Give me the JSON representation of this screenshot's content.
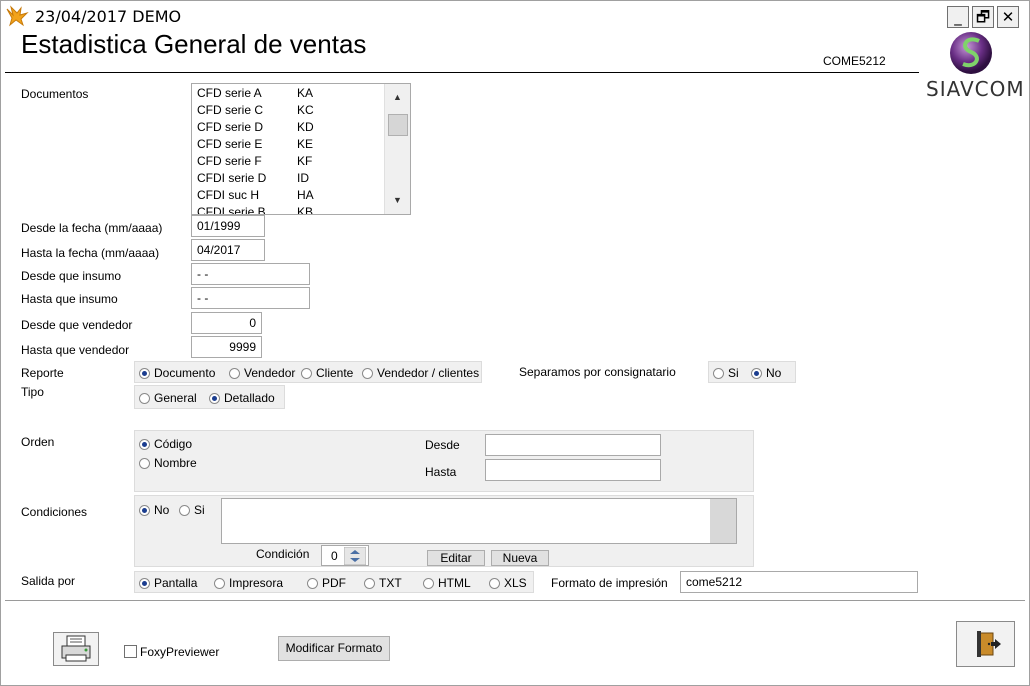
{
  "window": {
    "title": "23/04/2017  DEMO",
    "controls": {
      "minimize": "_",
      "restore": "🗗",
      "close": "✕"
    }
  },
  "header": {
    "heading": "Estadistica General de ventas",
    "program_code": "COME5212",
    "logo_text": "SIAVCOM"
  },
  "documentos": {
    "label": "Documentos",
    "items": [
      {
        "name": "CFD serie A",
        "code": "KA"
      },
      {
        "name": "CFD serie C",
        "code": "KC"
      },
      {
        "name": "CFD serie D",
        "code": "KD"
      },
      {
        "name": "CFD serie E",
        "code": "KE"
      },
      {
        "name": "CFD serie F",
        "code": "KF"
      },
      {
        "name": "CFDI  serie D",
        "code": "ID"
      },
      {
        "name": "CFDI  suc  H",
        "code": "HA"
      },
      {
        "name": "CFDI serie B",
        "code": "KB"
      }
    ]
  },
  "fields": {
    "desde_fecha": {
      "label": "Desde la fecha (mm/aaaa)",
      "value": "01/1999"
    },
    "hasta_fecha": {
      "label": "Hasta la fecha (mm/aaaa)",
      "value": "04/2017"
    },
    "desde_insumo": {
      "label": "Desde que insumo",
      "value": " - -"
    },
    "hasta_insumo": {
      "label": "Hasta que insumo",
      "value": " - -"
    },
    "desde_vendedor": {
      "label": "Desde que vendedor",
      "value": "0"
    },
    "hasta_vendedor": {
      "label": "Hasta que vendedor",
      "value": "9999"
    }
  },
  "reporte": {
    "label": "Reporte",
    "options": [
      "Documento",
      "Vendedor",
      "Cliente",
      "Vendedor / clientes"
    ],
    "selected": "Documento"
  },
  "consignatario": {
    "label": "Separamos por consignatario",
    "options": [
      "Si",
      "No"
    ],
    "selected": "No"
  },
  "tipo": {
    "label": "Tipo",
    "options": [
      "General",
      "Detallado"
    ],
    "selected": "Detallado"
  },
  "orden": {
    "label": "Orden",
    "options": [
      "Código",
      "Nombre"
    ],
    "selected": "Código",
    "desde_label": "Desde",
    "hasta_label": "Hasta",
    "desde_value": "",
    "hasta_value": ""
  },
  "condiciones": {
    "label": "Condiciones",
    "options": [
      "No",
      "Si"
    ],
    "selected": "No",
    "condicion_label": "Condición",
    "condicion_value": "0",
    "editar_label": "Editar",
    "nueva_label": "Nueva"
  },
  "salida": {
    "label": "Salida por",
    "options": [
      "Pantalla",
      "Impresora",
      "PDF",
      "TXT",
      "HTML",
      "XLS"
    ],
    "selected": "Pantalla",
    "formato_label": "Formato de impresión",
    "formato_value": "come5212"
  },
  "footer": {
    "foxy_label": "FoxyPreviewer",
    "foxy_checked": false,
    "modificar_label": "Modificar Formato",
    "print_icon": "printer-icon",
    "exit_icon": "exit-door-icon"
  }
}
